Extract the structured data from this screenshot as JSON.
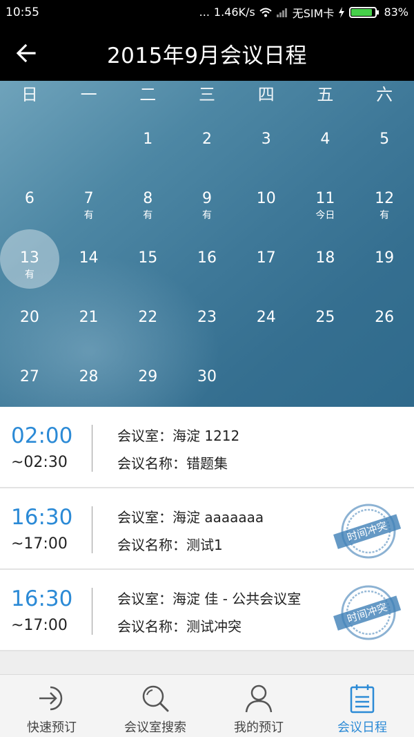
{
  "status_bar": {
    "time": "10:55",
    "dots": "...",
    "network_speed": "1.46K/s",
    "carrier": "无SIM卡",
    "battery_percent": "83%"
  },
  "header": {
    "title": "2015年9月会议日程"
  },
  "calendar": {
    "weekdays": [
      "日",
      "一",
      "二",
      "三",
      "四",
      "五",
      "六"
    ],
    "weeks": [
      [
        {
          "day": "",
          "mark": ""
        },
        {
          "day": "",
          "mark": ""
        },
        {
          "day": "1",
          "mark": ""
        },
        {
          "day": "2",
          "mark": ""
        },
        {
          "day": "3",
          "mark": ""
        },
        {
          "day": "4",
          "mark": ""
        },
        {
          "day": "5",
          "mark": ""
        }
      ],
      [
        {
          "day": "6",
          "mark": ""
        },
        {
          "day": "7",
          "mark": "有"
        },
        {
          "day": "8",
          "mark": "有"
        },
        {
          "day": "9",
          "mark": "有"
        },
        {
          "day": "10",
          "mark": ""
        },
        {
          "day": "11",
          "mark": "今日"
        },
        {
          "day": "12",
          "mark": "有"
        }
      ],
      [
        {
          "day": "13",
          "mark": "有",
          "selected": true
        },
        {
          "day": "14",
          "mark": ""
        },
        {
          "day": "15",
          "mark": ""
        },
        {
          "day": "16",
          "mark": ""
        },
        {
          "day": "17",
          "mark": ""
        },
        {
          "day": "18",
          "mark": ""
        },
        {
          "day": "19",
          "mark": ""
        }
      ],
      [
        {
          "day": "20",
          "mark": ""
        },
        {
          "day": "21",
          "mark": ""
        },
        {
          "day": "22",
          "mark": ""
        },
        {
          "day": "23",
          "mark": ""
        },
        {
          "day": "24",
          "mark": ""
        },
        {
          "day": "25",
          "mark": ""
        },
        {
          "day": "26",
          "mark": ""
        }
      ],
      [
        {
          "day": "27",
          "mark": ""
        },
        {
          "day": "28",
          "mark": ""
        },
        {
          "day": "29",
          "mark": ""
        },
        {
          "day": "30",
          "mark": ""
        },
        {
          "day": "",
          "mark": ""
        },
        {
          "day": "",
          "mark": ""
        },
        {
          "day": "",
          "mark": ""
        }
      ]
    ]
  },
  "meetings": [
    {
      "start": "02:00",
      "end": "~02:30",
      "room": "会议室：海淀 1212",
      "name": "会议名称：错题集",
      "conflict": false
    },
    {
      "start": "16:30",
      "end": "~17:00",
      "room": "会议室：海淀 aaaaaaa",
      "name": "会议名称：测试1",
      "conflict": true
    },
    {
      "start": "16:30",
      "end": "~17:00",
      "room": "会议室：海淀 佳 - 公共会议室",
      "name": "会议名称：测试冲突",
      "conflict": true
    }
  ],
  "conflict_stamp_label": "时间冲突",
  "bottom_nav": {
    "items": [
      {
        "label": "快速预订",
        "icon": "login-arrow-icon",
        "active": false
      },
      {
        "label": "会议室搜索",
        "icon": "search-icon",
        "active": false
      },
      {
        "label": "我的预订",
        "icon": "user-icon",
        "active": false
      },
      {
        "label": "会议日程",
        "icon": "calendar-list-icon",
        "active": true
      }
    ]
  },
  "colors": {
    "accent": "#2b8ad6",
    "stamp": "#3f7fb6"
  }
}
